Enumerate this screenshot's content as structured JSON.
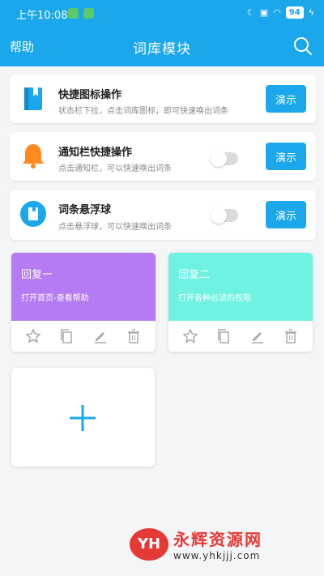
{
  "statusbar": {
    "time": "上午10:08",
    "battery": "94"
  },
  "header": {
    "left_label": "帮助",
    "title": "词库模块"
  },
  "features": [
    {
      "title": "快捷图标操作",
      "desc": "状态栏下拉，点击词库图标，即可快速唤出词条",
      "button": "演示"
    },
    {
      "title": "通知栏快捷操作",
      "desc": "点击通知栏，可以快速唤出词条",
      "button": "演示",
      "toggle": "off"
    },
    {
      "title": "词条悬浮球",
      "desc": "点击悬浮球，可以快速唤出词条",
      "button": "演示",
      "toggle": "off"
    }
  ],
  "replies": [
    {
      "title": "回复一",
      "desc": "打开首页-查看帮助",
      "color": "#b57bf2"
    },
    {
      "title": "回复二",
      "desc": "打开各种必须的权限",
      "color": "#6ff2e2"
    }
  ],
  "colors": {
    "accent": "#1aa7ec",
    "bell": "#ff8a1f"
  },
  "watermark": {
    "logo": "YH",
    "name": "永辉资源网",
    "url": "www.yhkjjj.com"
  }
}
